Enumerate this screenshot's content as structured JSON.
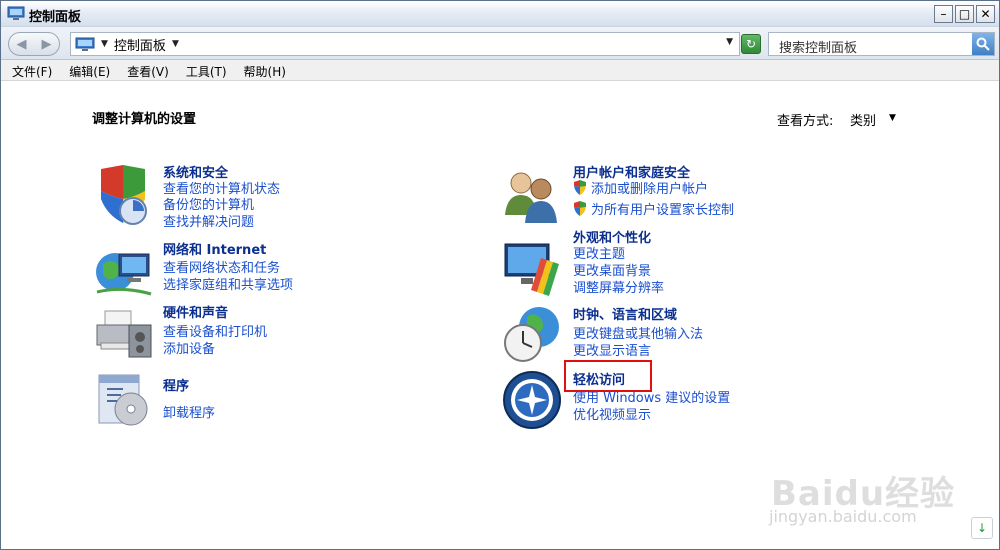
{
  "window": {
    "title": "控制面板"
  },
  "address": {
    "path": "控制面板",
    "search_placeholder": "搜索控制面板"
  },
  "menu": {
    "items": [
      "文件(F)",
      "编辑(E)",
      "查看(V)",
      "工具(T)",
      "帮助(H)"
    ]
  },
  "content": {
    "heading": "调整计算机的设置",
    "view_by_label": "查看方式:",
    "view_by_value": "类别"
  },
  "categories": {
    "system": {
      "title": "系统和安全",
      "links": [
        "查看您的计算机状态",
        "备份您的计算机",
        "查找并解决问题"
      ]
    },
    "network": {
      "title": "网络和 Internet",
      "links": [
        "查看网络状态和任务",
        "选择家庭组和共享选项"
      ]
    },
    "hardware": {
      "title": "硬件和声音",
      "links": [
        "查看设备和打印机",
        "添加设备"
      ]
    },
    "programs": {
      "title": "程序",
      "links": [
        "卸载程序"
      ]
    },
    "users": {
      "title": "用户帐户和家庭安全",
      "links": [
        "添加或删除用户帐户",
        "为所有用户设置家长控制"
      ]
    },
    "appearance": {
      "title": "外观和个性化",
      "links": [
        "更改主题",
        "更改桌面背景",
        "调整屏幕分辨率"
      ]
    },
    "clock": {
      "title": "时钟、语言和区域",
      "links": [
        "更改键盘或其他输入法",
        "更改显示语言"
      ]
    },
    "ease": {
      "title": "轻松访问",
      "links": [
        "使用 Windows 建议的设置",
        "优化视频显示"
      ]
    }
  },
  "watermark": {
    "brand": "Baidu经验",
    "url": "jingyan.baidu.com"
  },
  "colors": {
    "category_title": "#0b2f8f",
    "link": "#1a4fcf",
    "highlight": "#e01010"
  }
}
